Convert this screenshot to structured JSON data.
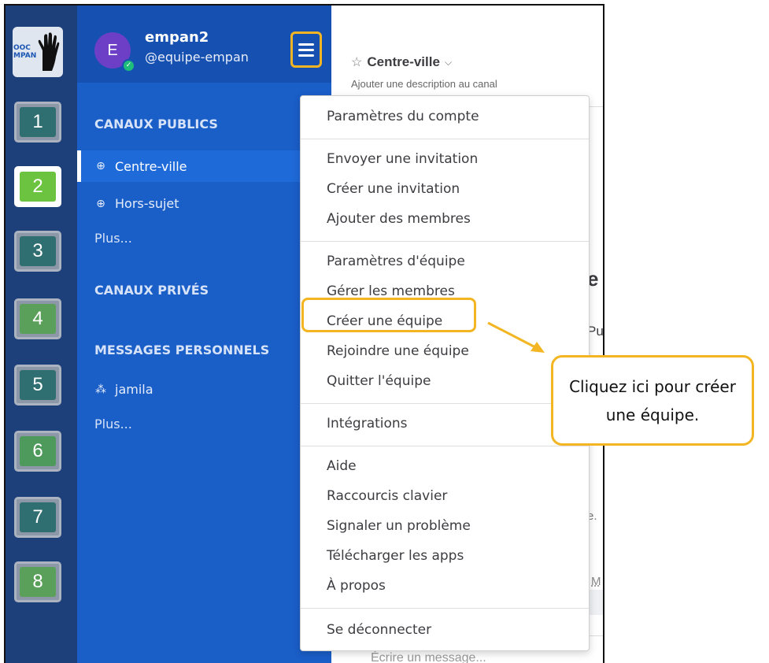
{
  "team_rail": {
    "logo_text": "OOC\nMPAN",
    "teams": [
      "1",
      "2",
      "3",
      "4",
      "5",
      "6",
      "7",
      "8"
    ],
    "active_team": "2",
    "colors": [
      "#2f6f71",
      "#6cc33f",
      "#2f6f71",
      "#5aa05a",
      "#2f6f71",
      "#4e9a5c",
      "#2f6f71",
      "#5aa05a"
    ]
  },
  "sidebar": {
    "avatar_letter": "E",
    "team_name": "empan2",
    "handle": "@equipe-empan",
    "sections": {
      "public": "CANAUX PUBLICS",
      "private": "CANAUX PRIVÉS",
      "direct": "MESSAGES PERSONNELS"
    },
    "public_channels": [
      "Centre-ville",
      "Hors-sujet"
    ],
    "more_public": "Plus...",
    "direct_messages": [
      "jamila"
    ],
    "more_direct": "Plus..."
  },
  "channel": {
    "title": "Centre-ville",
    "description": "Ajouter une description au canal",
    "peek_e": "e",
    "peek_pub": "Pub",
    "peek_dot": ".",
    "peek_e2": "e.",
    "peek_m": "M",
    "compose_placeholder": "Écrire un message..."
  },
  "menu": {
    "items": {
      "account_settings": "Paramètres du compte",
      "send_invite": "Envoyer une invitation",
      "create_invite": "Créer une invitation",
      "add_members": "Ajouter des membres",
      "team_settings": "Paramètres d'équipe",
      "manage_members": "Gérer les membres",
      "create_team": "Créer une équipe",
      "join_team": "Rejoindre une équipe",
      "leave_team": "Quitter l'équipe",
      "integrations": "Intégrations",
      "help": "Aide",
      "shortcuts": "Raccourcis clavier",
      "report_problem": "Signaler un problème",
      "download_apps": "Télécharger les apps",
      "about": "À propos",
      "logout": "Se déconnecter"
    }
  },
  "callout": {
    "text": "Cliquez ici pour créer une équipe."
  },
  "colors": {
    "sidebar": "#1a5ec8",
    "rail": "#1d3f7a",
    "highlight": "#f3b622"
  }
}
